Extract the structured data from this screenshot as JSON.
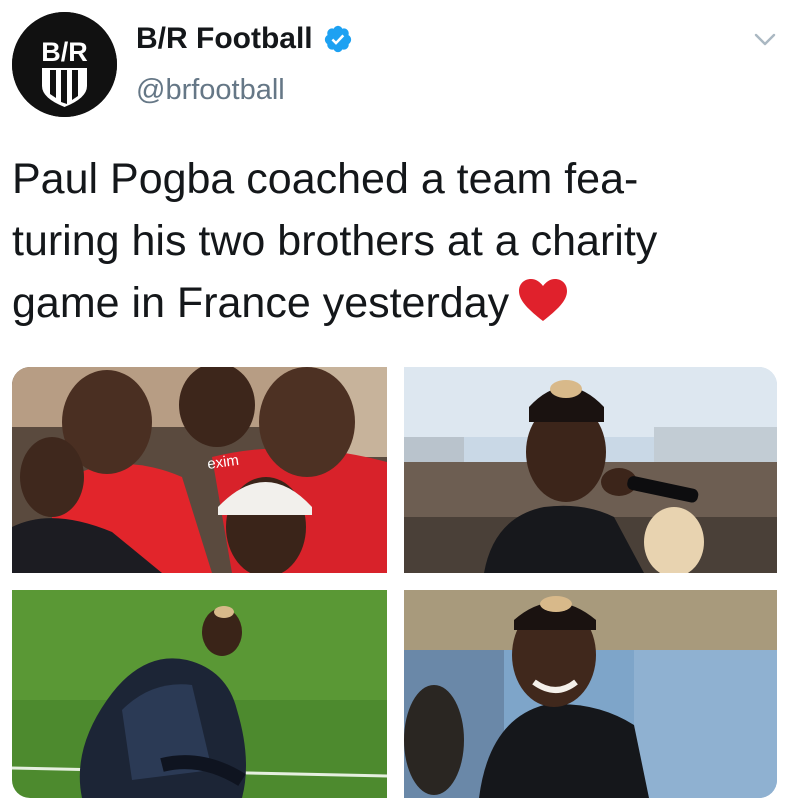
{
  "account": {
    "display_name": "B/R Football",
    "handle": "@brfootball",
    "avatar_text": "B/R",
    "verified": true
  },
  "tweet": {
    "lines": [
      "Paul Pogba coached a team fea-",
      "turing his two brothers at a charity",
      "game in France yesterday"
    ],
    "emoji": "red-heart"
  },
  "media": {
    "photos": [
      {
        "name": "photo-brothers-group",
        "shirt_text": "exim"
      },
      {
        "name": "photo-microphone"
      },
      {
        "name": "photo-crouching-pitch"
      },
      {
        "name": "photo-smiling-crowd"
      }
    ]
  },
  "icons": {
    "verified": "verified-badge-icon",
    "menu": "chevron-down-icon",
    "heart": "red-heart-icon"
  },
  "colors": {
    "verified_blue": "#1da1f2",
    "handle_gray": "#657786",
    "heart_red": "#e0212c",
    "text": "#14171a"
  }
}
